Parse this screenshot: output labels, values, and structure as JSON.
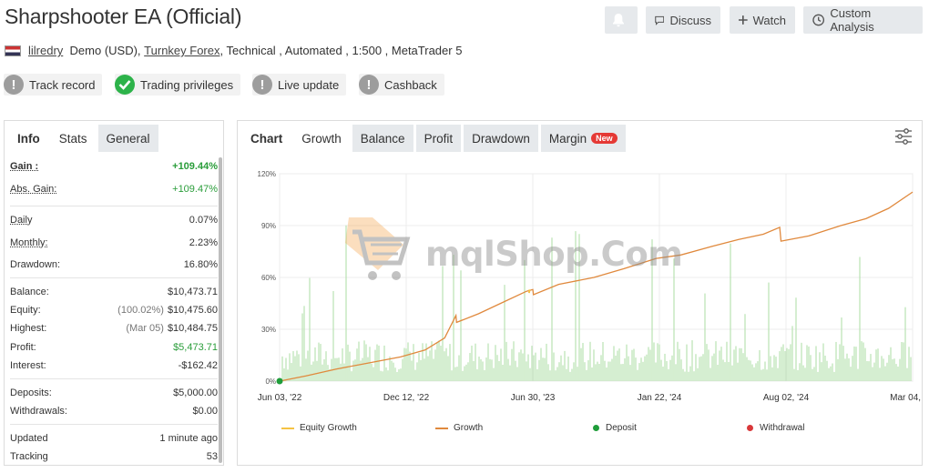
{
  "header": {
    "title": "Sharpshooter EA (Official)",
    "buttons": {
      "discuss": "Discuss",
      "watch": "Watch",
      "custom_analysis": "Custom Analysis"
    }
  },
  "subline": {
    "author": "lilredry",
    "account_type": "Demo (USD),",
    "broker": "Turnkey Forex",
    "details": ", Technical , Automated , 1:500 , MetaTrader 5"
  },
  "badges": [
    {
      "label": "Track record",
      "status": "grey"
    },
    {
      "label": "Trading privileges",
      "status": "green"
    },
    {
      "label": "Live update",
      "status": "grey"
    },
    {
      "label": "Cashback",
      "status": "grey"
    }
  ],
  "left_tabs": {
    "info": "Info",
    "stats": "Stats",
    "general": "General"
  },
  "stats": {
    "gain": {
      "label": "Gain :",
      "value": "+109.44%"
    },
    "abs_gain": {
      "label": "Abs. Gain:",
      "value": "+109.47%"
    },
    "daily": {
      "label": "Daily",
      "value": "0.07%"
    },
    "monthly": {
      "label": "Monthly:",
      "value": "2.23%"
    },
    "drawdown": {
      "label": "Drawdown:",
      "value": "16.80%"
    },
    "balance": {
      "label": "Balance:",
      "value": "$10,473.71"
    },
    "equity": {
      "label": "Equity:",
      "pre": "(100.02%)",
      "value": "$10,475.60"
    },
    "highest": {
      "label": "Highest:",
      "pre": "(Mar 05)",
      "value": "$10,484.75"
    },
    "profit": {
      "label": "Profit:",
      "value": "$5,473.71"
    },
    "interest": {
      "label": "Interest:",
      "value": "-$162.42"
    },
    "deposits": {
      "label": "Deposits:",
      "value": "$5,000.00"
    },
    "withdrawals": {
      "label": "Withdrawals:",
      "value": "$0.00"
    },
    "updated": {
      "label": "Updated",
      "value": "1 minute ago"
    },
    "tracking": {
      "label": "Tracking",
      "value": "53"
    }
  },
  "chart_tabs": {
    "chart": "Chart",
    "growth": "Growth",
    "balance": "Balance",
    "profit": "Profit",
    "drawdown": "Drawdown",
    "margin": "Margin",
    "new": "New"
  },
  "watermark": "mqlShop.Com",
  "colors": {
    "growth": "#e0893d",
    "equity": "#f5c343",
    "deposit": "#1f9d3a",
    "withdrawal": "#d9383a",
    "volume": "#b9e3b2"
  },
  "chart_data": {
    "type": "line",
    "x_ticks": [
      "Jun 03, '22",
      "Dec 12, '22",
      "Jun 30, '23",
      "Jan 22, '24",
      "Aug 02, '24",
      "Mar 04, '25"
    ],
    "y_ticks": [
      "0%",
      "30%",
      "60%",
      "90%",
      "120%"
    ],
    "ylim": [
      0,
      120
    ],
    "x_start": "2022-06-03",
    "x_end": "2025-03-04",
    "series": [
      {
        "name": "Growth",
        "points": [
          [
            "2022-06-03",
            0
          ],
          [
            "2022-07-15",
            3
          ],
          [
            "2022-09-01",
            7
          ],
          [
            "2022-10-15",
            10
          ],
          [
            "2022-12-12",
            14
          ],
          [
            "2023-01-20",
            18
          ],
          [
            "2023-02-20",
            25
          ],
          [
            "2023-03-10",
            38
          ],
          [
            "2023-03-11",
            34
          ],
          [
            "2023-04-15",
            39
          ],
          [
            "2023-05-20",
            45
          ],
          [
            "2023-06-30",
            52
          ],
          [
            "2023-07-10",
            53
          ],
          [
            "2023-07-11",
            50
          ],
          [
            "2023-08-20",
            56
          ],
          [
            "2023-10-15",
            60
          ],
          [
            "2023-12-01",
            65
          ],
          [
            "2024-01-22",
            71
          ],
          [
            "2024-03-01",
            73
          ],
          [
            "2024-04-20",
            78
          ],
          [
            "2024-06-01",
            82
          ],
          [
            "2024-07-10",
            85
          ],
          [
            "2024-08-05",
            89
          ],
          [
            "2024-08-07",
            81
          ],
          [
            "2024-09-20",
            84
          ],
          [
            "2024-11-10",
            90
          ],
          [
            "2024-12-20",
            94
          ],
          [
            "2025-01-25",
            100
          ],
          [
            "2025-03-04",
            109.44
          ]
        ]
      },
      {
        "name": "Equity Growth",
        "points": [
          [
            "2023-07-04",
            51
          ],
          [
            "2023-07-05",
            53
          ]
        ]
      }
    ],
    "markers": [
      {
        "type": "Deposit",
        "x": "2022-06-03",
        "y": 0
      }
    ],
    "legend": [
      "Equity Growth",
      "Growth",
      "Deposit",
      "Withdrawal"
    ],
    "legend_position": "bottom",
    "grid": true
  }
}
